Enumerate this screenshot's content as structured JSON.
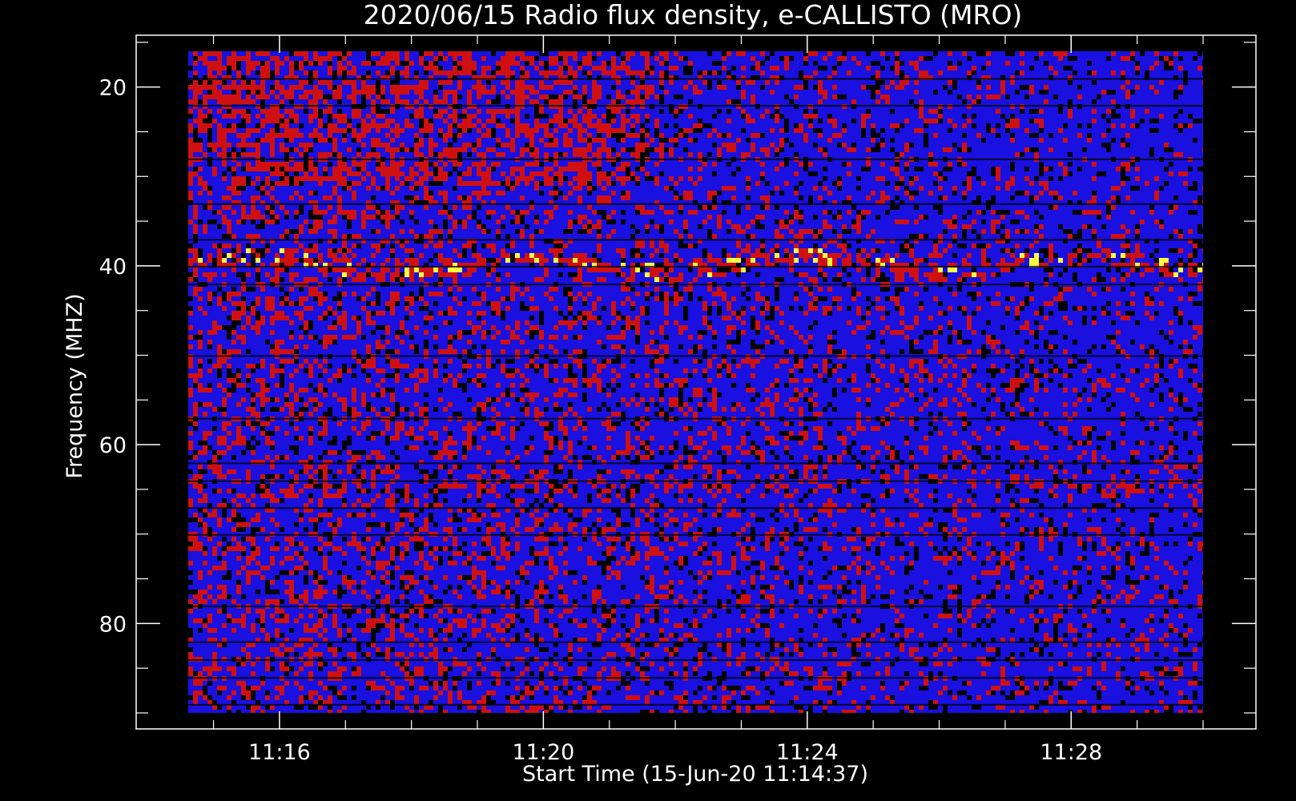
{
  "chart_data": {
    "type": "heatmap",
    "title": "2020/06/15  Radio flux density, e-CALLISTO (MRO)",
    "xlabel": "Start Time (15-Jun-20 11:14:37)",
    "ylabel": "Frequency (MHZ)",
    "x_ticks": [
      "11:16",
      "11:20",
      "11:24",
      "11:28"
    ],
    "y_ticks": [
      "20",
      "40",
      "60",
      "80"
    ],
    "x_tick_minutes": [
      16,
      20,
      24,
      28
    ],
    "y_tick_values": [
      20,
      40,
      60,
      80
    ],
    "x_range_minutes": [
      14.617,
      30.0
    ],
    "y_range_mhz": [
      16,
      90
    ],
    "y_axis_inverted": true,
    "colormap": {
      "low": "#000000",
      "mid": "#1a10e0",
      "high": "#d01010",
      "peak": "#ffff40"
    },
    "features": {
      "banded_rows_mhz": [
        19,
        22,
        28,
        33,
        37,
        40,
        42,
        50,
        57,
        62,
        64,
        67,
        70,
        78,
        82,
        84,
        86,
        89
      ],
      "hot_band_mhz": 39.5,
      "secondary_band_mhz": 64,
      "notes": ""
    }
  }
}
